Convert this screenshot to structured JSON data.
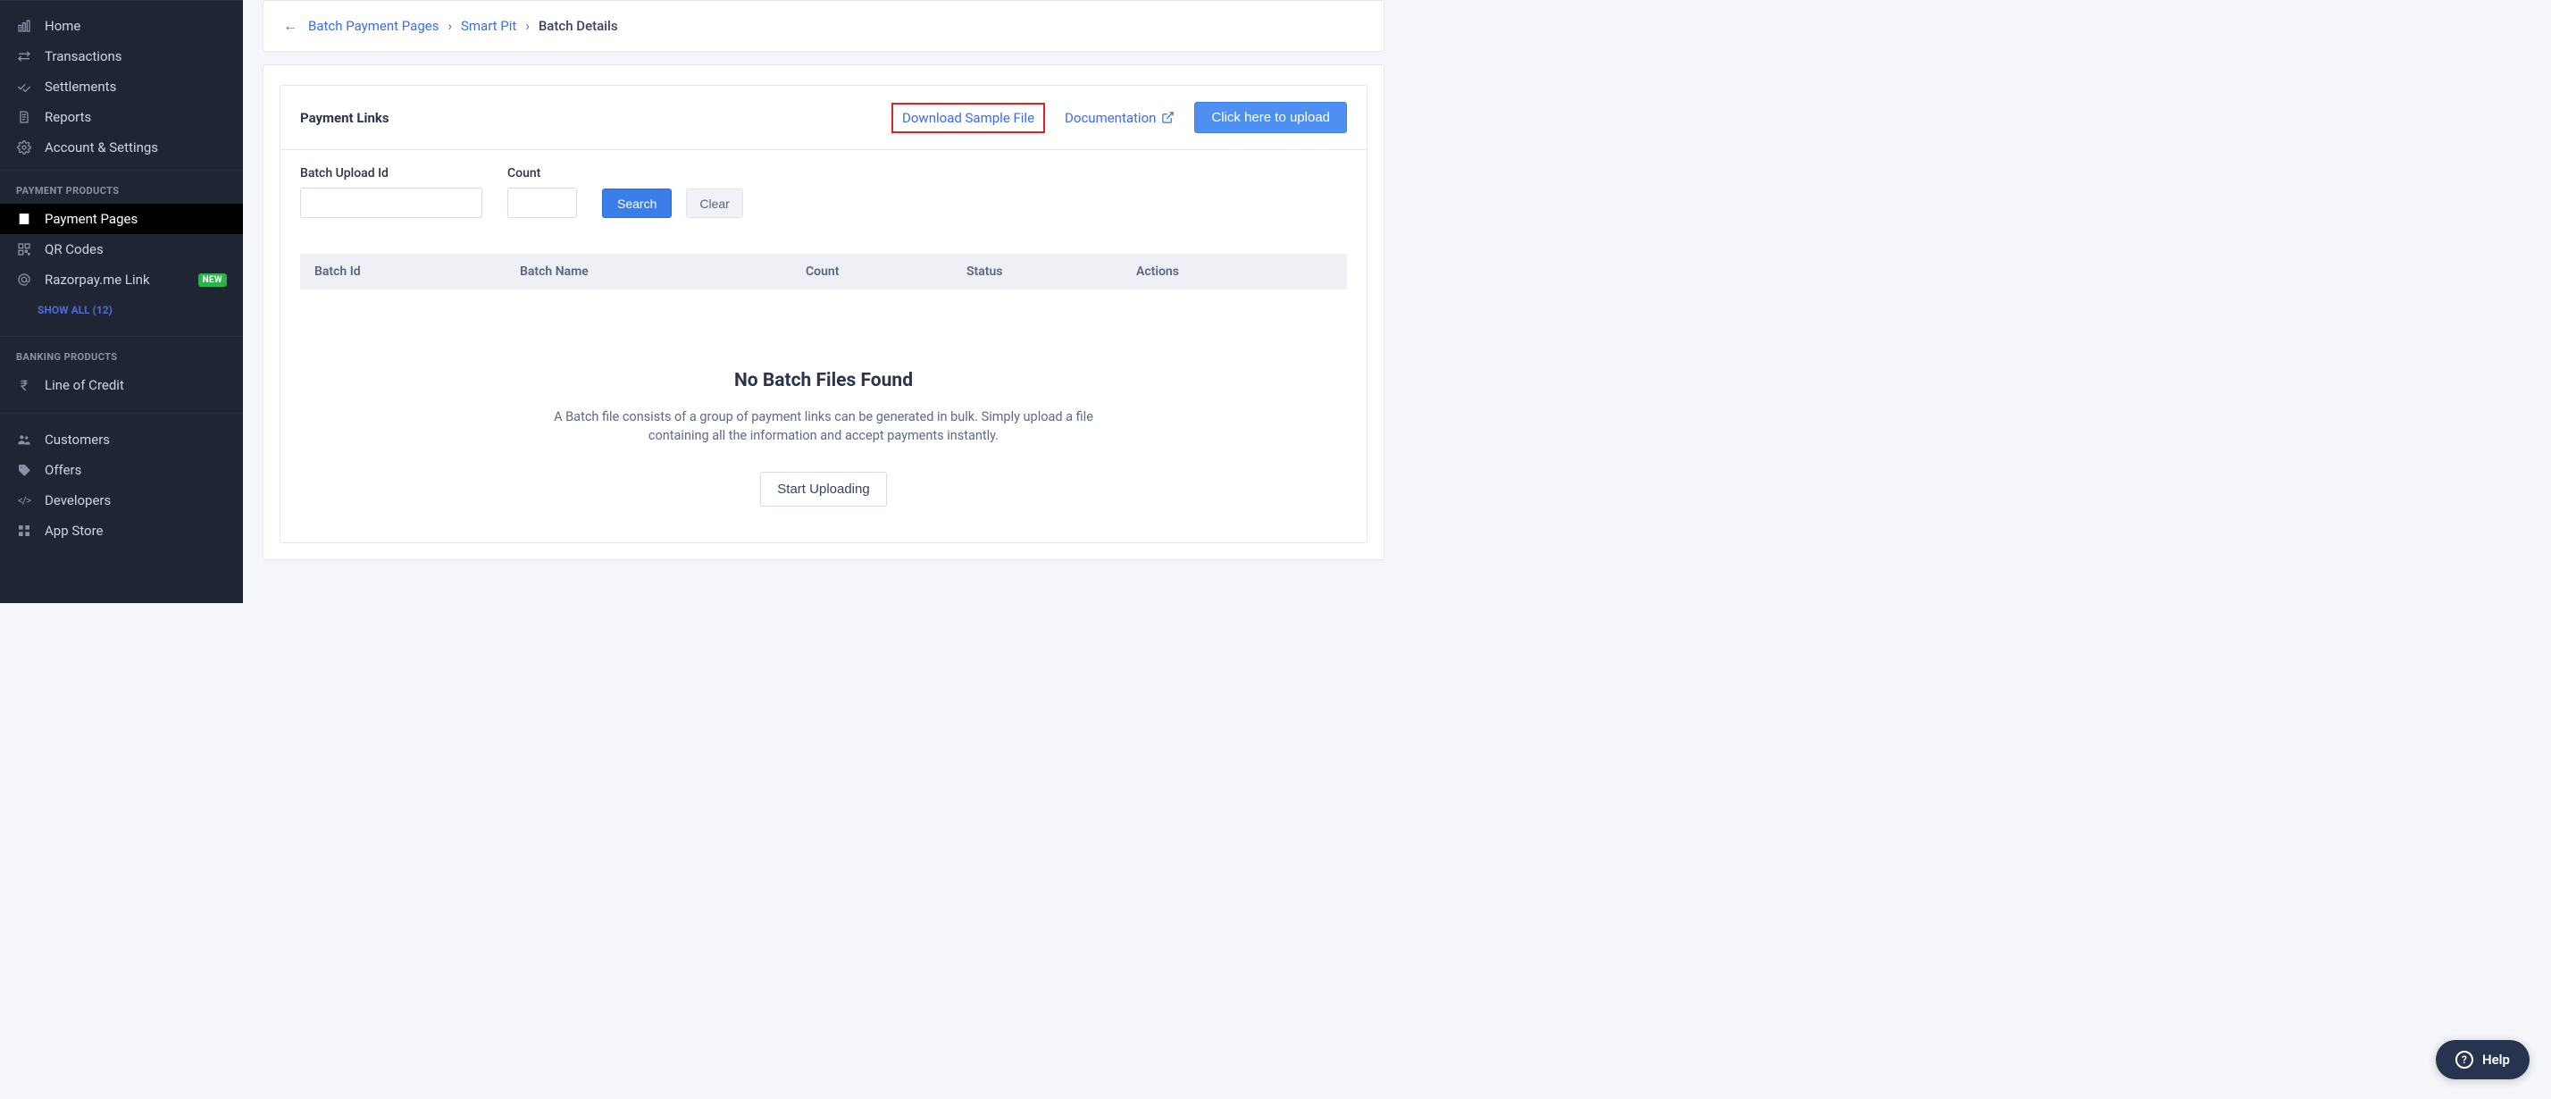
{
  "sidebar": {
    "nav1": [
      {
        "label": "Home"
      },
      {
        "label": "Transactions"
      },
      {
        "label": "Settlements"
      },
      {
        "label": "Reports"
      },
      {
        "label": "Account & Settings"
      }
    ],
    "section_payment": "PAYMENT PRODUCTS",
    "payment_items": [
      {
        "label": "Payment Pages",
        "active": true
      },
      {
        "label": "QR Codes"
      },
      {
        "label": "Razorpay.me Link",
        "badge": "NEW"
      }
    ],
    "show_all": "SHOW ALL (12)",
    "section_banking": "BANKING PRODUCTS",
    "banking_items": [
      {
        "label": "Line of Credit"
      }
    ],
    "nav2": [
      {
        "label": "Customers"
      },
      {
        "label": "Offers"
      },
      {
        "label": "Developers"
      },
      {
        "label": "App Store"
      }
    ]
  },
  "breadcrumb": {
    "l1": "Batch Payment Pages",
    "l2": "Smart Pit",
    "current": "Batch Details"
  },
  "card": {
    "title": "Payment Links",
    "download_sample": "Download Sample File",
    "documentation": "Documentation",
    "upload_btn": "Click here to upload"
  },
  "filters": {
    "batchid_label": "Batch Upload Id",
    "count_label": "Count",
    "search": "Search",
    "clear": "Clear"
  },
  "table": {
    "columns": [
      "Batch Id",
      "Batch Name",
      "Count",
      "Status",
      "Actions"
    ]
  },
  "empty": {
    "title": "No Batch Files Found",
    "description": "A Batch file consists of a group of payment links can be generated in bulk. Simply upload a file containing all the information and accept payments instantly.",
    "button": "Start Uploading"
  },
  "help": "Help"
}
